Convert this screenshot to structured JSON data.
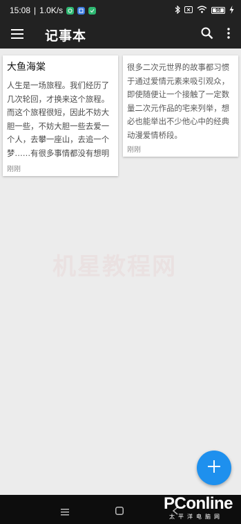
{
  "status_bar": {
    "time": "15:08",
    "network_speed": "1.0K/s",
    "battery_level": "98",
    "icons": [
      "app-icon-1",
      "app-icon-2",
      "app-icon-3",
      "bluetooth-icon",
      "no-sim-icon",
      "wifi-icon",
      "battery-icon",
      "charging-icon"
    ]
  },
  "app_bar": {
    "title": "记事本",
    "menu_icon": "hamburger-menu-icon",
    "search_icon": "search-icon",
    "more_icon": "more-vert-icon"
  },
  "notes": [
    {
      "title": "大鱼海棠",
      "body": "人生是一场旅程。我们经历了几次轮回，才换来这个旅程。而这个旅程很短，因此不妨大胆一些，不妨大胆一些去爱一个人，去攀一座山，去追一个梦……有很多事情都没有想明白，但还是要去做的。",
      "time": "刚刚"
    },
    {
      "title": "",
      "body": "很多二次元世界的故事都习惯于通过爱情元素来吸引观众，即使随便让一个接触了一定数量二次元作品的宅来列举，想必也能举出不少他心中的经典动漫爱情桥段。",
      "time": "刚刚"
    }
  ],
  "fab": {
    "icon": "plus-icon",
    "accent": "#1e90ee"
  },
  "watermark": "机星教程网",
  "nav_bar": {
    "icons": [
      "menu-nav-icon",
      "home-nav-icon",
      "back-nav-icon"
    ]
  },
  "brand": {
    "name": "PConline",
    "sub": "太平洋电脑网"
  },
  "colors": {
    "bar_background": "#222222",
    "page_background": "#ececec",
    "card_background": "#ffffff"
  }
}
